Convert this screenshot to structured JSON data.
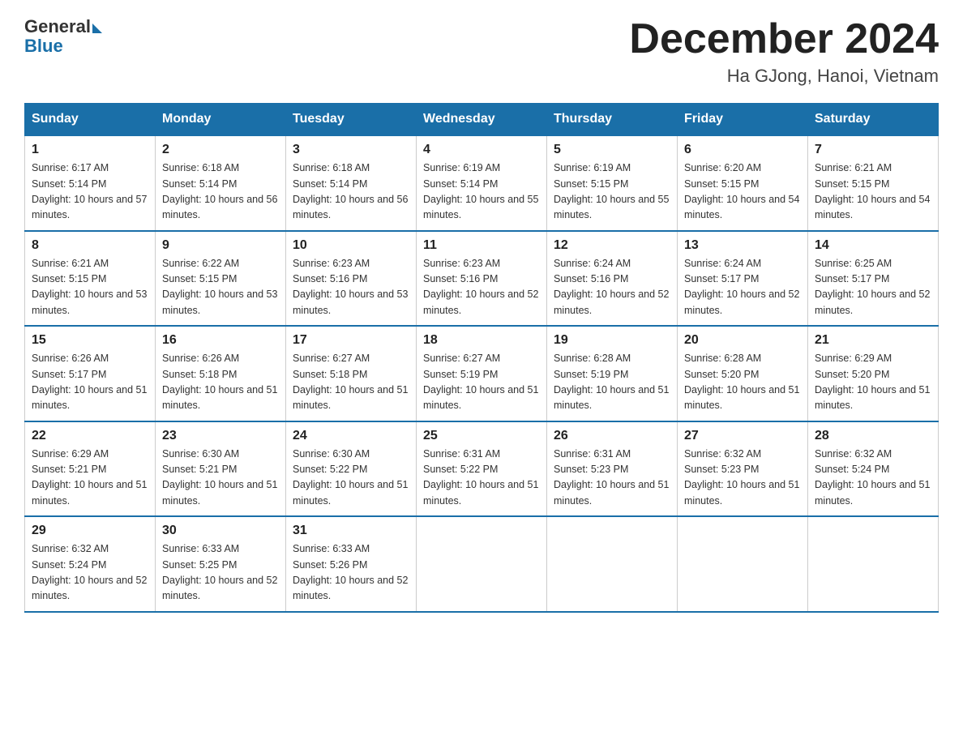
{
  "header": {
    "logo_general": "General",
    "logo_blue": "Blue",
    "month_title": "December 2024",
    "location": "Ha GJong, Hanoi, Vietnam"
  },
  "days_of_week": [
    "Sunday",
    "Monday",
    "Tuesday",
    "Wednesday",
    "Thursday",
    "Friday",
    "Saturday"
  ],
  "weeks": [
    [
      {
        "day": "1",
        "sunrise": "6:17 AM",
        "sunset": "5:14 PM",
        "daylight": "10 hours and 57 minutes."
      },
      {
        "day": "2",
        "sunrise": "6:18 AM",
        "sunset": "5:14 PM",
        "daylight": "10 hours and 56 minutes."
      },
      {
        "day": "3",
        "sunrise": "6:18 AM",
        "sunset": "5:14 PM",
        "daylight": "10 hours and 56 minutes."
      },
      {
        "day": "4",
        "sunrise": "6:19 AM",
        "sunset": "5:14 PM",
        "daylight": "10 hours and 55 minutes."
      },
      {
        "day": "5",
        "sunrise": "6:19 AM",
        "sunset": "5:15 PM",
        "daylight": "10 hours and 55 minutes."
      },
      {
        "day": "6",
        "sunrise": "6:20 AM",
        "sunset": "5:15 PM",
        "daylight": "10 hours and 54 minutes."
      },
      {
        "day": "7",
        "sunrise": "6:21 AM",
        "sunset": "5:15 PM",
        "daylight": "10 hours and 54 minutes."
      }
    ],
    [
      {
        "day": "8",
        "sunrise": "6:21 AM",
        "sunset": "5:15 PM",
        "daylight": "10 hours and 53 minutes."
      },
      {
        "day": "9",
        "sunrise": "6:22 AM",
        "sunset": "5:15 PM",
        "daylight": "10 hours and 53 minutes."
      },
      {
        "day": "10",
        "sunrise": "6:23 AM",
        "sunset": "5:16 PM",
        "daylight": "10 hours and 53 minutes."
      },
      {
        "day": "11",
        "sunrise": "6:23 AM",
        "sunset": "5:16 PM",
        "daylight": "10 hours and 52 minutes."
      },
      {
        "day": "12",
        "sunrise": "6:24 AM",
        "sunset": "5:16 PM",
        "daylight": "10 hours and 52 minutes."
      },
      {
        "day": "13",
        "sunrise": "6:24 AM",
        "sunset": "5:17 PM",
        "daylight": "10 hours and 52 minutes."
      },
      {
        "day": "14",
        "sunrise": "6:25 AM",
        "sunset": "5:17 PM",
        "daylight": "10 hours and 52 minutes."
      }
    ],
    [
      {
        "day": "15",
        "sunrise": "6:26 AM",
        "sunset": "5:17 PM",
        "daylight": "10 hours and 51 minutes."
      },
      {
        "day": "16",
        "sunrise": "6:26 AM",
        "sunset": "5:18 PM",
        "daylight": "10 hours and 51 minutes."
      },
      {
        "day": "17",
        "sunrise": "6:27 AM",
        "sunset": "5:18 PM",
        "daylight": "10 hours and 51 minutes."
      },
      {
        "day": "18",
        "sunrise": "6:27 AM",
        "sunset": "5:19 PM",
        "daylight": "10 hours and 51 minutes."
      },
      {
        "day": "19",
        "sunrise": "6:28 AM",
        "sunset": "5:19 PM",
        "daylight": "10 hours and 51 minutes."
      },
      {
        "day": "20",
        "sunrise": "6:28 AM",
        "sunset": "5:20 PM",
        "daylight": "10 hours and 51 minutes."
      },
      {
        "day": "21",
        "sunrise": "6:29 AM",
        "sunset": "5:20 PM",
        "daylight": "10 hours and 51 minutes."
      }
    ],
    [
      {
        "day": "22",
        "sunrise": "6:29 AM",
        "sunset": "5:21 PM",
        "daylight": "10 hours and 51 minutes."
      },
      {
        "day": "23",
        "sunrise": "6:30 AM",
        "sunset": "5:21 PM",
        "daylight": "10 hours and 51 minutes."
      },
      {
        "day": "24",
        "sunrise": "6:30 AM",
        "sunset": "5:22 PM",
        "daylight": "10 hours and 51 minutes."
      },
      {
        "day": "25",
        "sunrise": "6:31 AM",
        "sunset": "5:22 PM",
        "daylight": "10 hours and 51 minutes."
      },
      {
        "day": "26",
        "sunrise": "6:31 AM",
        "sunset": "5:23 PM",
        "daylight": "10 hours and 51 minutes."
      },
      {
        "day": "27",
        "sunrise": "6:32 AM",
        "sunset": "5:23 PM",
        "daylight": "10 hours and 51 minutes."
      },
      {
        "day": "28",
        "sunrise": "6:32 AM",
        "sunset": "5:24 PM",
        "daylight": "10 hours and 51 minutes."
      }
    ],
    [
      {
        "day": "29",
        "sunrise": "6:32 AM",
        "sunset": "5:24 PM",
        "daylight": "10 hours and 52 minutes."
      },
      {
        "day": "30",
        "sunrise": "6:33 AM",
        "sunset": "5:25 PM",
        "daylight": "10 hours and 52 minutes."
      },
      {
        "day": "31",
        "sunrise": "6:33 AM",
        "sunset": "5:26 PM",
        "daylight": "10 hours and 52 minutes."
      },
      null,
      null,
      null,
      null
    ]
  ]
}
